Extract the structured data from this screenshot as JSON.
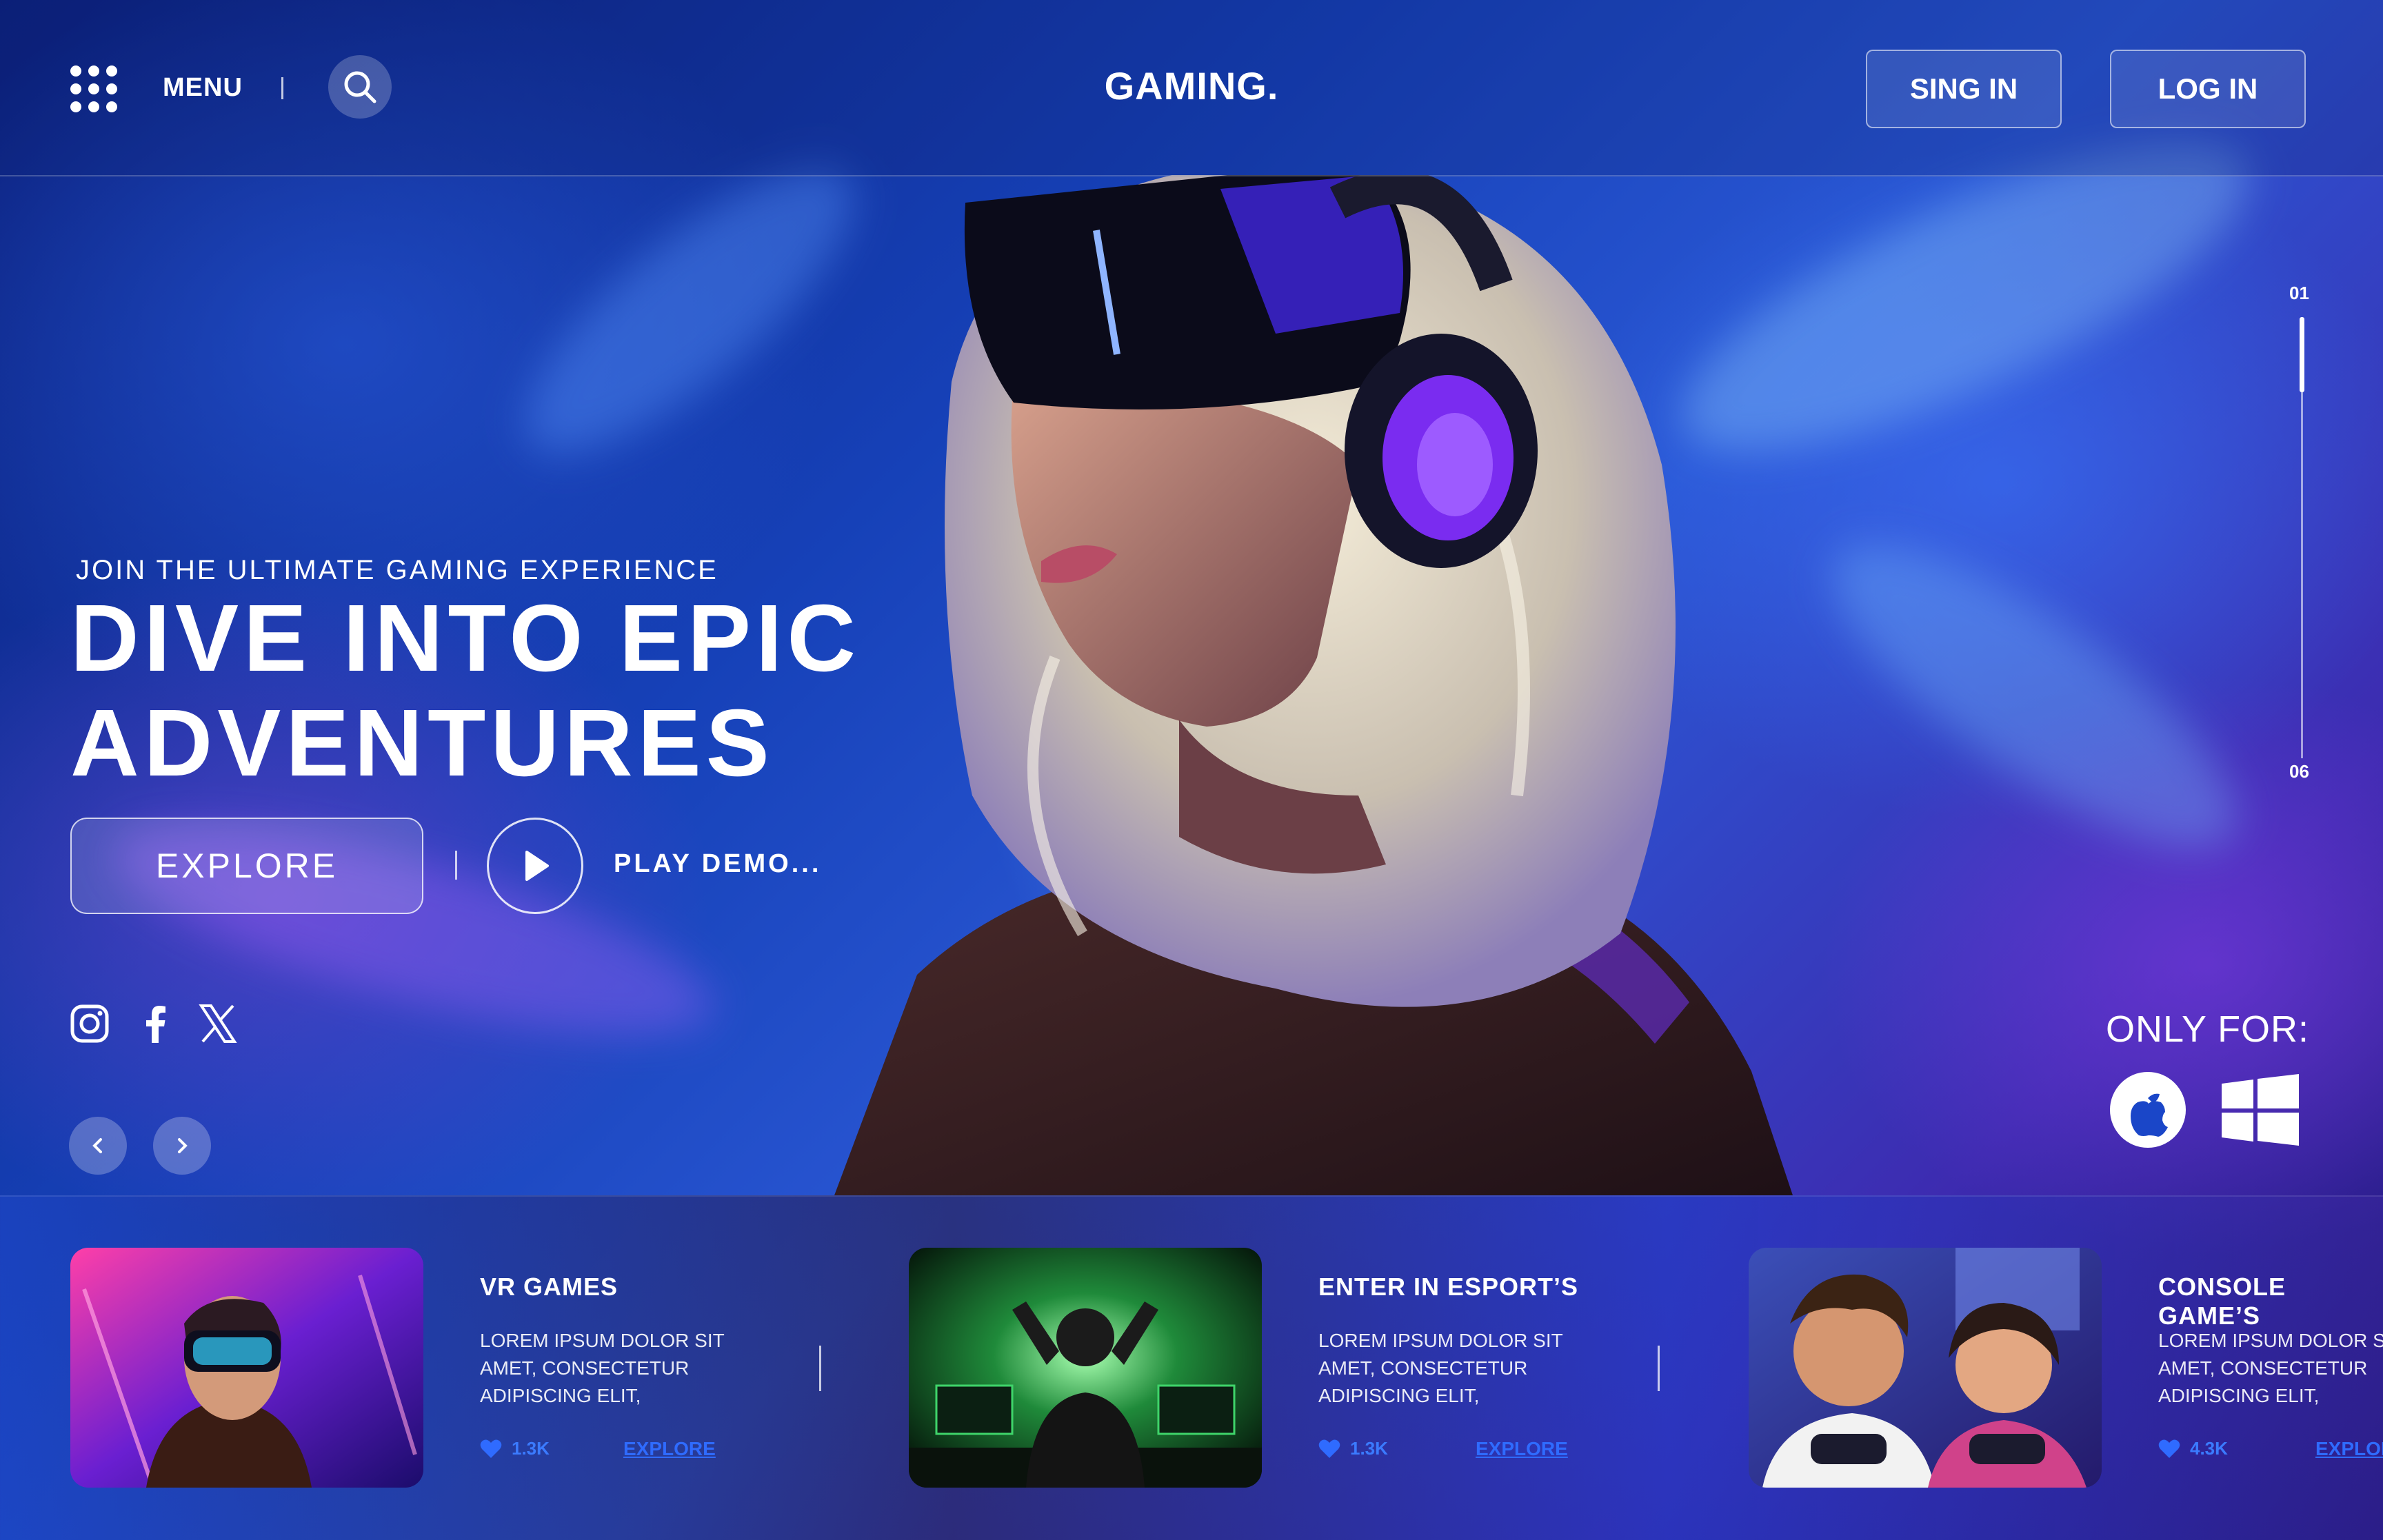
{
  "header": {
    "menu_label": "MENU",
    "brand": "GAMING.",
    "signin_label": "SING IN",
    "login_label": "LOG IN"
  },
  "hero": {
    "kicker": "JOIN THE ULTIMATE GAMING EXPERIENCE",
    "headline_line1": "DIVE INTO EPIC",
    "headline_line2": "ADVENTURES",
    "explore_label": "EXPLORE",
    "play_label": "PLAY DEMO..."
  },
  "slider": {
    "current": "01",
    "total": "06",
    "progress_fraction": 0.17
  },
  "social": [
    "instagram-icon",
    "facebook-icon",
    "x-icon"
  ],
  "platforms": {
    "label": "ONLY FOR:",
    "items": [
      "apple-icon",
      "windows-icon"
    ]
  },
  "cards": [
    {
      "title": "VR GAMES",
      "desc": "LOREM IPSUM DOLOR SIT AMET, CONSECTETUR ADIPISCING ELIT,",
      "likes": "1.3K",
      "link": "EXPLORE"
    },
    {
      "title": "ENTER IN ESPORT’S",
      "desc": "LOREM IPSUM DOLOR SIT AMET, CONSECTETUR ADIPISCING ELIT,",
      "likes": "1.3K",
      "link": "EXPLORE"
    },
    {
      "title": "CONSOLE GAME’S",
      "desc": "LOREM IPSUM DOLOR SIT AMET, CONSECTETUR ADIPISCING ELIT,",
      "likes": "4.3K",
      "link": "EXPLORE"
    }
  ],
  "colors": {
    "accent": "#2f6bff",
    "background": "#1641b8",
    "purple": "#7a2cf0"
  }
}
